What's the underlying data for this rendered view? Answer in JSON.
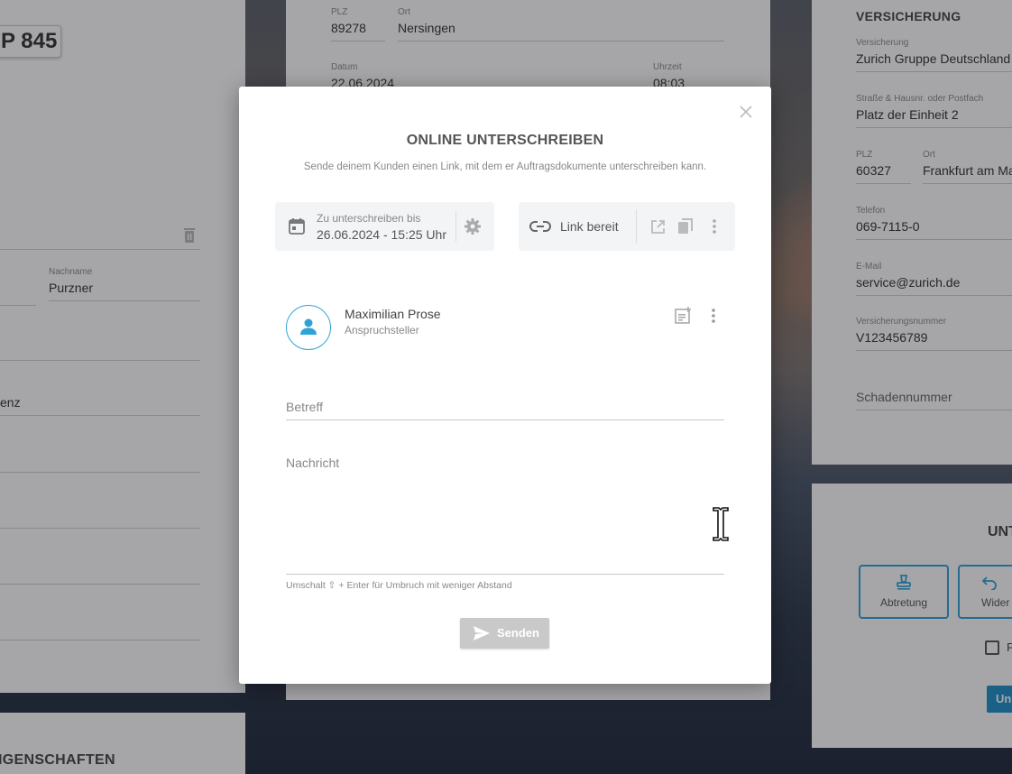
{
  "background": {
    "left_panel": {
      "plate": "P 845",
      "nachname_label": "Nachname",
      "nachname_value": "Purzner",
      "partial_value": "enz",
      "bottom_heading": "IGENSCHAFTEN"
    },
    "center_panel": {
      "plz_label": "PLZ",
      "plz_value": "89278",
      "ort_label": "Ort",
      "ort_value": "Nersingen",
      "datum_label": "Datum",
      "datum_value": "22.06.2024",
      "uhrzeit_label": "Uhrzeit",
      "uhrzeit_value": "08:03"
    },
    "right_panel": {
      "heading": "VERSICHERUNG",
      "versicherung_label": "Versicherung",
      "versicherung_value": "Zurich Gruppe Deutschland",
      "strasse_label": "Straße & Hausnr. oder Postfach",
      "strasse_value": "Platz der Einheit 2",
      "plz_label": "PLZ",
      "plz_value": "60327",
      "ort_label": "Ort",
      "ort_value": "Frankfurt am Main",
      "telefon_label": "Telefon",
      "telefon_value": "069-7115-0",
      "email_label": "E-Mail",
      "email_value": "service@zurich.de",
      "vnr_label": "Versicherungsnummer",
      "vnr_value": "V123456789",
      "schadennummer_placeholder": "Schadennummer"
    },
    "right_lower_panel": {
      "heading": "UNT",
      "abtretung_label": "Abtretung",
      "wider_label": "Wider",
      "checkbox_label": "F",
      "button_label": "Un"
    }
  },
  "modal": {
    "title": "ONLINE UNTERSCHREIBEN",
    "subtitle": "Sende deinem Kunden einen Link, mit dem er Auftragsdokumente unterschreiben kann.",
    "deadline": {
      "label": "Zu unterschreiben bis",
      "value": "26.06.2024 - 15:25 Uhr"
    },
    "link_status": "Link bereit",
    "signer": {
      "name": "Maximilian Prose",
      "role": "Anspruchsteller"
    },
    "betreff_placeholder": "Betreff",
    "nachricht_placeholder": "Nachricht",
    "hint": "Umschalt ⇧ + Enter für Umbruch mit weniger Abstand",
    "send_label": "Senden"
  },
  "colors": {
    "accent": "#2ea3d6",
    "send_button_disabled": "#c9c9c9"
  }
}
